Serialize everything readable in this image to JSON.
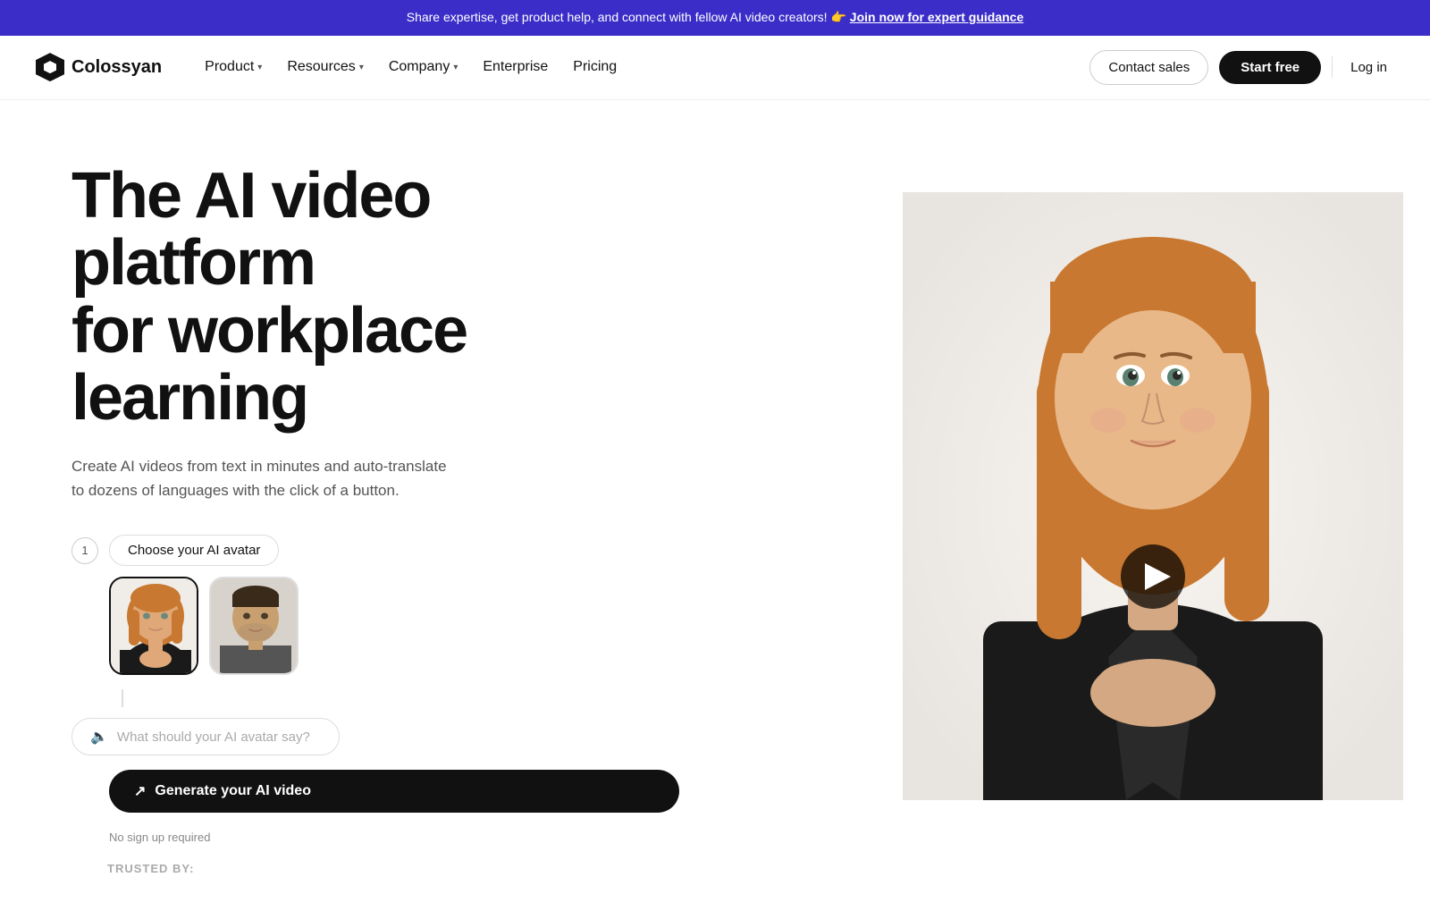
{
  "banner": {
    "text": "Share expertise, get product help, and connect with fellow AI video creators! 👉 ",
    "link_text": "Join now for expert guidance",
    "emoji": "👉"
  },
  "nav": {
    "logo_text": "Colossyan",
    "menu_items": [
      {
        "label": "Product",
        "has_dropdown": true
      },
      {
        "label": "Resources",
        "has_dropdown": true
      },
      {
        "label": "Company",
        "has_dropdown": true
      },
      {
        "label": "Enterprise",
        "has_dropdown": false
      },
      {
        "label": "Pricing",
        "has_dropdown": false
      }
    ],
    "contact_sales": "Contact sales",
    "start_free": "Start free",
    "log_in": "Log in"
  },
  "hero": {
    "title_line1": "The AI video platform",
    "title_line2": "for workplace learning",
    "subtitle": "Create AI videos from text in minutes and auto-translate\nto dozens of languages with the click of a button.",
    "step1": {
      "number": "1",
      "label": "Choose your AI avatar"
    },
    "step2": {
      "placeholder": "What should your AI avatar say?"
    },
    "generate_btn": "Generate your AI video",
    "no_signup": "No sign up required",
    "trusted_label": "TRUSTED BY:"
  }
}
